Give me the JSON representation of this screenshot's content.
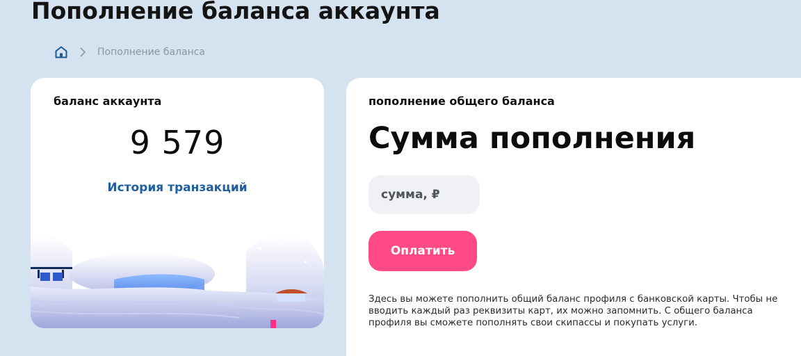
{
  "page": {
    "title": "Пополнение баланса аккаунта"
  },
  "breadcrumb": {
    "home_icon": "home-icon",
    "separator_icon": "chevron-right-icon",
    "current": "Пополнение баланса"
  },
  "balance_card": {
    "heading": "баланс аккаунта",
    "value": "9 579",
    "history_link": "История транзакций"
  },
  "topup_card": {
    "heading": "пополнение общего баланса",
    "title": "Сумма пополнения",
    "amount_value": "",
    "amount_placeholder": "сумма, ₽",
    "pay_button": "Оплатить",
    "info": "Здесь вы можете пополнить общий баланс профиля с банковской карты. Чтобы не вводить каждый раз реквизиты карт, их можно запомнить. С общего баланса профиля вы сможете пополнять свои скипассы и покупать услуги."
  },
  "colors": {
    "background": "#d4e3ef",
    "accent_pink": "#ff4a86",
    "link_blue": "#1f5f9f",
    "icon_blue": "#1e5a8e"
  }
}
